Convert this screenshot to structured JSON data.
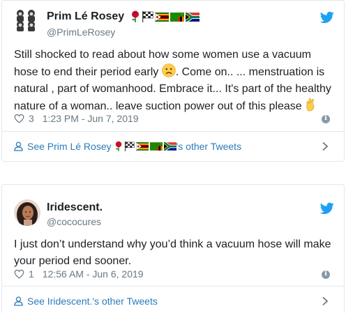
{
  "tweets": [
    {
      "author_name": "Prim Lé Rosey",
      "handle": "@PrimLeRosey",
      "text_part1": "Still shocked to read about how some women use a vacuum hose to end their period early",
      "text_part2": ". Come on.. ... menstruation is natural , part of womanhood. Embrace it... It's part of the healthy nature of a woman.. leave suction power out of this please",
      "like_count": "3",
      "timestamp": "1:23 PM - Jun 7, 2019",
      "see_more_prefix": "See Prim Lé Rosey",
      "see_more_suffix": "'s other Tweets",
      "emojis": [
        "rose",
        "checkered-flag",
        "zimbabwe-flag",
        "zambia-flag",
        "south-africa-flag"
      ]
    },
    {
      "author_name": "Iridescent.",
      "handle": "@cococures",
      "text": "I just don’t understand why you’d think a vacuum hose will make your period end sooner.",
      "like_count": "1",
      "timestamp": "12:56 AM - Jun 6, 2019",
      "see_more": "See Iridescent.'s other Tweets"
    }
  ],
  "colors": {
    "link": "#2b7bb9",
    "twitter_blue": "#1da1f2",
    "meta_gray": "#697882",
    "text": "#1c2022",
    "border": "#e1e8ed"
  }
}
